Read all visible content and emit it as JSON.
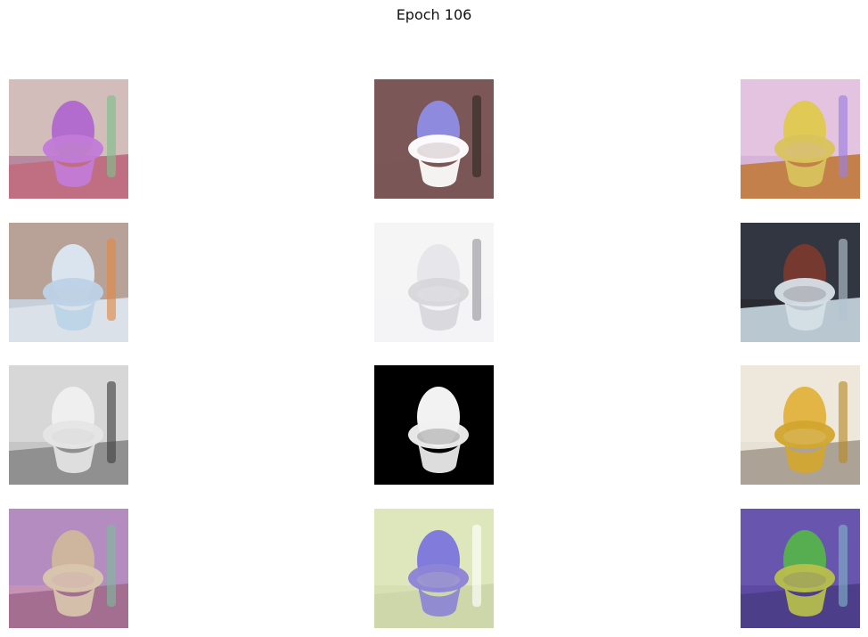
{
  "figure": {
    "title": "Epoch 106"
  },
  "grid": {
    "rows": 4,
    "cols": 3,
    "images": [
      {
        "name": "sample-r1-c1",
        "bg": "#b78aa0",
        "wall": "#d7c5bf",
        "floor": "#c06b7d",
        "toilet": "#c27bd9",
        "lid": "#b067cf",
        "accent": "#7fbf8a"
      },
      {
        "name": "sample-r1-c2",
        "bg": "#7b5758",
        "wall": "#7b5758",
        "floor": "#7b5758",
        "toilet": "#ffffff",
        "lid": "#8f8de6",
        "accent": "#2f2a22"
      },
      {
        "name": "sample-r1-c3",
        "bg": "#d6b3d9",
        "wall": "#e6c6e2",
        "floor": "#c27a3b",
        "toilet": "#d8c45c",
        "lid": "#e0c94d",
        "accent": "#9b7ee0"
      },
      {
        "name": "sample-r2-c1",
        "bg": "#c7cfd9",
        "wall": "#b59a8c",
        "floor": "#dbe2ea",
        "toilet": "#bcd2e6",
        "lid": "#dbe8f2",
        "accent": "#e08a48"
      },
      {
        "name": "sample-r2-c2",
        "bg": "#f4f4f6",
        "wall": "#f4f4f6",
        "floor": "#f4f4f6",
        "toilet": "#d7d7db",
        "lid": "#e6e6ea",
        "accent": "#9a9aa0"
      },
      {
        "name": "sample-r2-c3",
        "bg": "#2a2b31",
        "wall": "#343844",
        "floor": "#c8d8e2",
        "toilet": "#d6dfe6",
        "lid": "#7a3a2e",
        "accent": "#b2c4d1"
      },
      {
        "name": "sample-r3-c1",
        "bg": "#c6c6c6",
        "wall": "#d9d9d9",
        "floor": "#8a8a8a",
        "toilet": "#e5e5e5",
        "lid": "#f0f0f0",
        "accent": "#444444"
      },
      {
        "name": "sample-r3-c2",
        "bg": "#000000",
        "wall": "#000000",
        "floor": "#000000",
        "toilet": "#f0f0f0",
        "lid": "#ffffff",
        "accent": "#000000"
      },
      {
        "name": "sample-r3-c3",
        "bg": "#e6e1d4",
        "wall": "#eee8dd",
        "floor": "#a59b8e",
        "toilet": "#d2a72f",
        "lid": "#e0b23b",
        "accent": "#b98c2a"
      },
      {
        "name": "sample-r4-c1",
        "bg": "#c692b6",
        "wall": "#b18bc2",
        "floor": "#a06a8c",
        "toilet": "#d8c6ad",
        "lid": "#cfb79c",
        "accent": "#7fb79d"
      },
      {
        "name": "sample-r4-c2",
        "bg": "#d6e0b2",
        "wall": "#dfe6bd",
        "floor": "#cdd6a7",
        "toilet": "#8c84d6",
        "lid": "#7b75dd",
        "accent": "#ffffff"
      },
      {
        "name": "sample-r4-c3",
        "bg": "#5f4aa3",
        "wall": "#6a57b0",
        "floor": "#4a3d86",
        "toilet": "#b7c04a",
        "lid": "#56b34b",
        "accent": "#7fb0c6"
      }
    ]
  }
}
